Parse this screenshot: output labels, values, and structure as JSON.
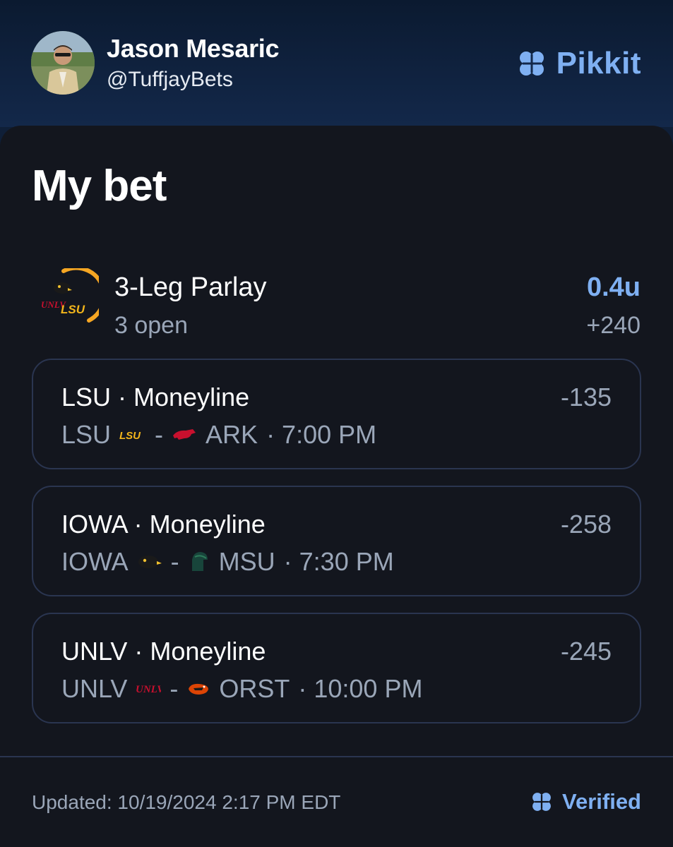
{
  "header": {
    "user_name": "Jason Mesaric",
    "user_handle": "@TuffjayBets",
    "brand": "Pikkit"
  },
  "card": {
    "title": "My bet",
    "parlay": {
      "title": "3-Leg Parlay",
      "status": "3 open",
      "units": "0.4u",
      "odds": "+240",
      "progress_fraction": 0.4
    },
    "legs": [
      {
        "title": "LSU · Moneyline",
        "odds": "-135",
        "team": "LSU",
        "separator": "-",
        "opponent": "ARK",
        "time": "· 7:00 PM",
        "team_logo_text": "LSU",
        "team_logo_icon": "lsu-logo-icon",
        "opponent_logo_icon": "razorback-logo-icon"
      },
      {
        "title": "IOWA · Moneyline",
        "odds": "-258",
        "team": "IOWA",
        "separator": "-",
        "opponent": "MSU",
        "time": "· 7:30 PM",
        "team_logo_icon": "hawkeye-logo-icon",
        "opponent_logo_icon": "spartan-logo-icon"
      },
      {
        "title": "UNLV · Moneyline",
        "odds": "-245",
        "team": "UNLV",
        "separator": "-",
        "opponent": "ORST",
        "time": "· 10:00 PM",
        "team_logo_text": "UNLV",
        "team_logo_icon": "unlv-logo-icon",
        "opponent_logo_icon": "beaver-logo-icon"
      }
    ]
  },
  "footer": {
    "updated": "Updated: 10/19/2024 2:17 PM EDT",
    "verified": "Verified"
  },
  "colors": {
    "accent": "#7fb0f2",
    "background": "#13161e",
    "header": "#0f1f38",
    "muted": "#9aa6b8",
    "progress_arc": "#f5a623"
  }
}
